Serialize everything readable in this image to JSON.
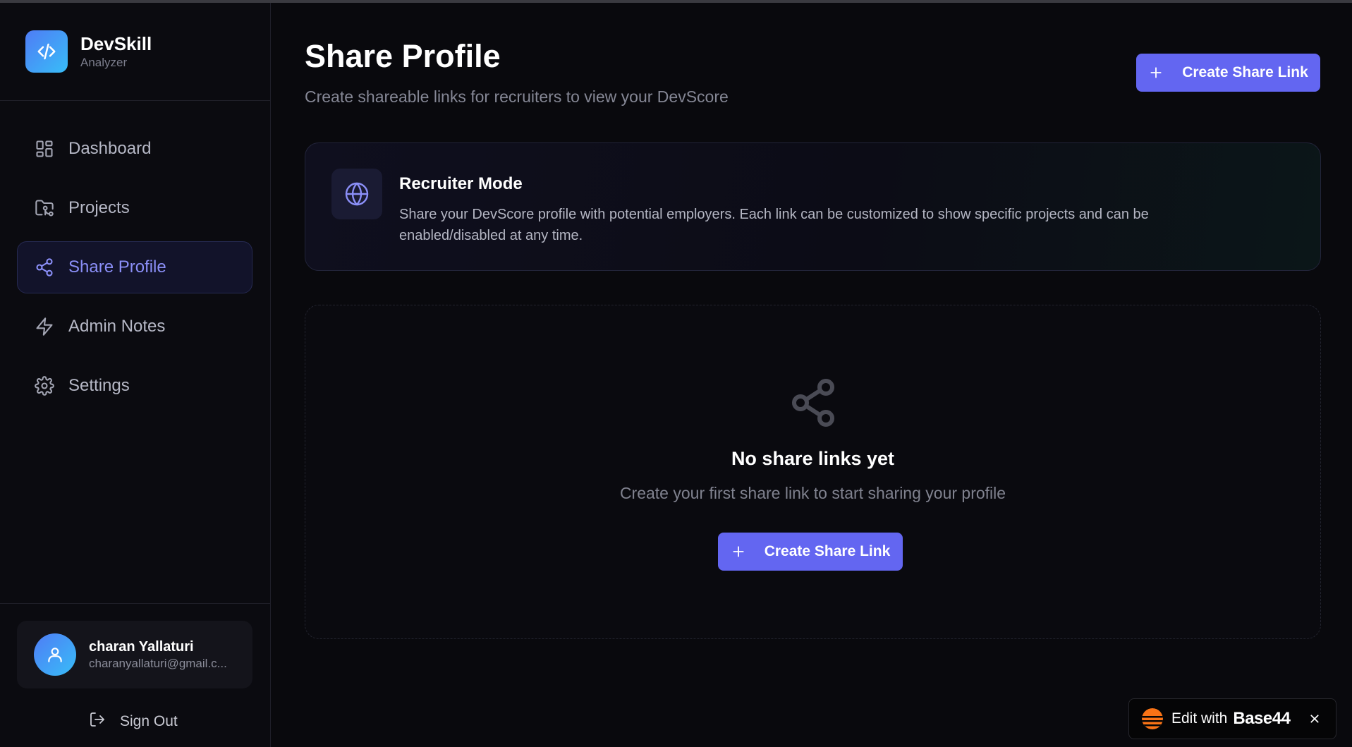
{
  "brand": {
    "name": "DevSkill",
    "subtitle": "Analyzer",
    "icon": "code-icon"
  },
  "sidebar": {
    "items": [
      {
        "label": "Dashboard",
        "icon": "grid-icon",
        "active": false
      },
      {
        "label": "Projects",
        "icon": "folder-git-icon",
        "active": false
      },
      {
        "label": "Share Profile",
        "icon": "share-icon",
        "active": true
      },
      {
        "label": "Admin Notes",
        "icon": "lightning-icon",
        "active": false
      },
      {
        "label": "Settings",
        "icon": "gear-icon",
        "active": false
      }
    ],
    "user": {
      "name": "charan Yallaturi",
      "email": "charanyallaturi@gmail.c...",
      "icon": "user-icon"
    },
    "signout_label": "Sign Out"
  },
  "header": {
    "title": "Share Profile",
    "subtitle": "Create shareable links for recruiters to view your DevScore",
    "create_button_label": "Create Share Link"
  },
  "info_card": {
    "title": "Recruiter Mode",
    "description": "Share your DevScore profile with potential employers. Each link can be customized to show specific projects and can be enabled/disabled at any time.",
    "icon": "globe-icon"
  },
  "empty_state": {
    "title": "No share links yet",
    "description": "Create your first share link to start sharing your profile",
    "button_label": "Create Share Link",
    "icon": "share-icon"
  },
  "badge": {
    "prefix": "Edit with",
    "brand": "Base44"
  },
  "colors": {
    "accent": "#6366f1",
    "active_text": "#8b8ff8",
    "background": "#09090d",
    "logo_gradient_start": "#4f7cf5",
    "logo_gradient_end": "#38bdf8"
  }
}
